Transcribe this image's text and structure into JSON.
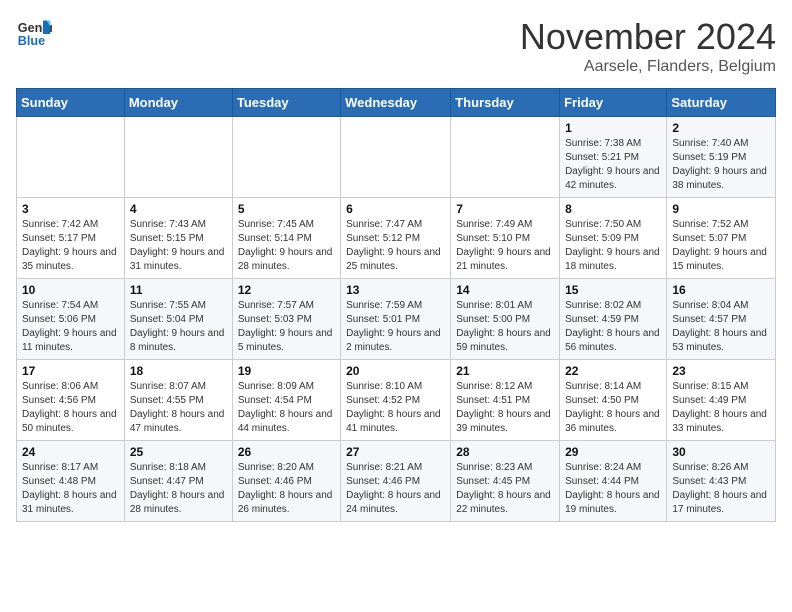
{
  "header": {
    "logo_general": "General",
    "logo_blue": "Blue",
    "month_title": "November 2024",
    "location": "Aarsele, Flanders, Belgium"
  },
  "days_of_week": [
    "Sunday",
    "Monday",
    "Tuesday",
    "Wednesday",
    "Thursday",
    "Friday",
    "Saturday"
  ],
  "weeks": [
    [
      {
        "day": "",
        "info": ""
      },
      {
        "day": "",
        "info": ""
      },
      {
        "day": "",
        "info": ""
      },
      {
        "day": "",
        "info": ""
      },
      {
        "day": "",
        "info": ""
      },
      {
        "day": "1",
        "info": "Sunrise: 7:38 AM\nSunset: 5:21 PM\nDaylight: 9 hours and 42 minutes."
      },
      {
        "day": "2",
        "info": "Sunrise: 7:40 AM\nSunset: 5:19 PM\nDaylight: 9 hours and 38 minutes."
      }
    ],
    [
      {
        "day": "3",
        "info": "Sunrise: 7:42 AM\nSunset: 5:17 PM\nDaylight: 9 hours and 35 minutes."
      },
      {
        "day": "4",
        "info": "Sunrise: 7:43 AM\nSunset: 5:15 PM\nDaylight: 9 hours and 31 minutes."
      },
      {
        "day": "5",
        "info": "Sunrise: 7:45 AM\nSunset: 5:14 PM\nDaylight: 9 hours and 28 minutes."
      },
      {
        "day": "6",
        "info": "Sunrise: 7:47 AM\nSunset: 5:12 PM\nDaylight: 9 hours and 25 minutes."
      },
      {
        "day": "7",
        "info": "Sunrise: 7:49 AM\nSunset: 5:10 PM\nDaylight: 9 hours and 21 minutes."
      },
      {
        "day": "8",
        "info": "Sunrise: 7:50 AM\nSunset: 5:09 PM\nDaylight: 9 hours and 18 minutes."
      },
      {
        "day": "9",
        "info": "Sunrise: 7:52 AM\nSunset: 5:07 PM\nDaylight: 9 hours and 15 minutes."
      }
    ],
    [
      {
        "day": "10",
        "info": "Sunrise: 7:54 AM\nSunset: 5:06 PM\nDaylight: 9 hours and 11 minutes."
      },
      {
        "day": "11",
        "info": "Sunrise: 7:55 AM\nSunset: 5:04 PM\nDaylight: 9 hours and 8 minutes."
      },
      {
        "day": "12",
        "info": "Sunrise: 7:57 AM\nSunset: 5:03 PM\nDaylight: 9 hours and 5 minutes."
      },
      {
        "day": "13",
        "info": "Sunrise: 7:59 AM\nSunset: 5:01 PM\nDaylight: 9 hours and 2 minutes."
      },
      {
        "day": "14",
        "info": "Sunrise: 8:01 AM\nSunset: 5:00 PM\nDaylight: 8 hours and 59 minutes."
      },
      {
        "day": "15",
        "info": "Sunrise: 8:02 AM\nSunset: 4:59 PM\nDaylight: 8 hours and 56 minutes."
      },
      {
        "day": "16",
        "info": "Sunrise: 8:04 AM\nSunset: 4:57 PM\nDaylight: 8 hours and 53 minutes."
      }
    ],
    [
      {
        "day": "17",
        "info": "Sunrise: 8:06 AM\nSunset: 4:56 PM\nDaylight: 8 hours and 50 minutes."
      },
      {
        "day": "18",
        "info": "Sunrise: 8:07 AM\nSunset: 4:55 PM\nDaylight: 8 hours and 47 minutes."
      },
      {
        "day": "19",
        "info": "Sunrise: 8:09 AM\nSunset: 4:54 PM\nDaylight: 8 hours and 44 minutes."
      },
      {
        "day": "20",
        "info": "Sunrise: 8:10 AM\nSunset: 4:52 PM\nDaylight: 8 hours and 41 minutes."
      },
      {
        "day": "21",
        "info": "Sunrise: 8:12 AM\nSunset: 4:51 PM\nDaylight: 8 hours and 39 minutes."
      },
      {
        "day": "22",
        "info": "Sunrise: 8:14 AM\nSunset: 4:50 PM\nDaylight: 8 hours and 36 minutes."
      },
      {
        "day": "23",
        "info": "Sunrise: 8:15 AM\nSunset: 4:49 PM\nDaylight: 8 hours and 33 minutes."
      }
    ],
    [
      {
        "day": "24",
        "info": "Sunrise: 8:17 AM\nSunset: 4:48 PM\nDaylight: 8 hours and 31 minutes."
      },
      {
        "day": "25",
        "info": "Sunrise: 8:18 AM\nSunset: 4:47 PM\nDaylight: 8 hours and 28 minutes."
      },
      {
        "day": "26",
        "info": "Sunrise: 8:20 AM\nSunset: 4:46 PM\nDaylight: 8 hours and 26 minutes."
      },
      {
        "day": "27",
        "info": "Sunrise: 8:21 AM\nSunset: 4:46 PM\nDaylight: 8 hours and 24 minutes."
      },
      {
        "day": "28",
        "info": "Sunrise: 8:23 AM\nSunset: 4:45 PM\nDaylight: 8 hours and 22 minutes."
      },
      {
        "day": "29",
        "info": "Sunrise: 8:24 AM\nSunset: 4:44 PM\nDaylight: 8 hours and 19 minutes."
      },
      {
        "day": "30",
        "info": "Sunrise: 8:26 AM\nSunset: 4:43 PM\nDaylight: 8 hours and 17 minutes."
      }
    ]
  ]
}
